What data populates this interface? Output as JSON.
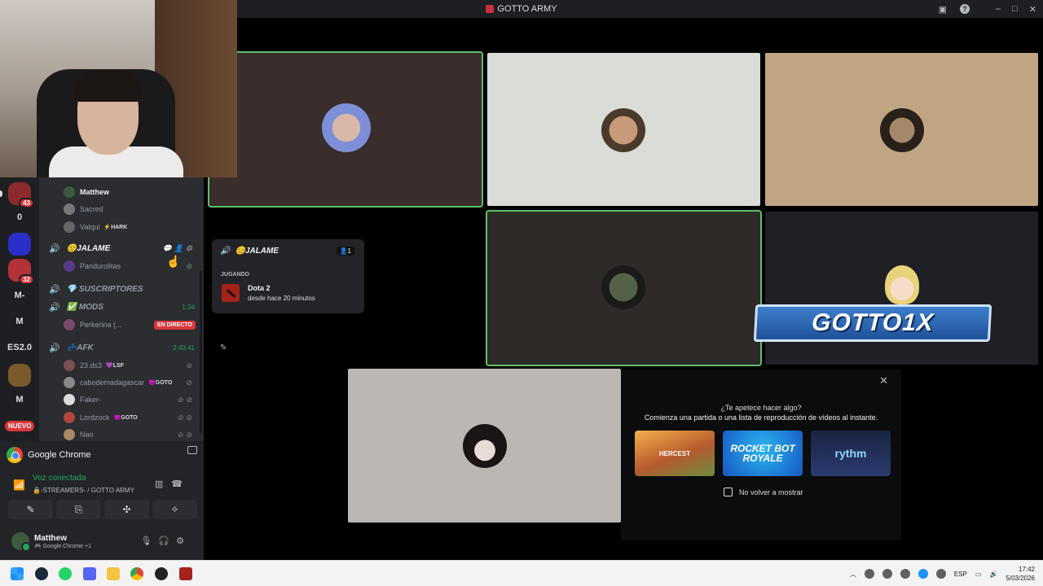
{
  "window": {
    "title": "GOTTO ARMY",
    "controls": [
      "–",
      "□",
      "✕"
    ]
  },
  "servers": [
    {
      "label": "",
      "badge": "43",
      "color": "#8b2b2b",
      "icon": "server-avatar-icon"
    },
    {
      "label": "0",
      "badge": "",
      "color": "#1e1f22",
      "icon": ""
    },
    {
      "label": "",
      "badge": "",
      "color": "#2b2fc9",
      "icon": "server-logo-icon"
    },
    {
      "label": "",
      "badge": "32",
      "color": "#b3323a",
      "icon": "server-avatar-icon"
    },
    {
      "label": "M-",
      "badge": "",
      "color": "#1e1f22",
      "icon": ""
    },
    {
      "label": "M",
      "badge": "",
      "color": "#1e1f22",
      "icon": ""
    },
    {
      "label": "ES2.0",
      "badge": "",
      "color": "#1e1f22",
      "icon": ""
    },
    {
      "label": "",
      "badge": "",
      "color": "#7a5a2a",
      "icon": "server-helmet-icon"
    },
    {
      "label": "M",
      "badge": "",
      "color": "#1e1f22",
      "icon": ""
    }
  ],
  "nuevo_badge": "NUEVO",
  "channel_list": {
    "users_top": [
      {
        "name": "Matthew",
        "tag": "",
        "bright": true,
        "avatar_color": "#3d5a40"
      },
      {
        "name": "Sacred",
        "tag": "",
        "bright": false,
        "avatar_color": "#777"
      },
      {
        "name": "Valqui",
        "tag": "⚡HARK",
        "bright": false,
        "avatar_color": "#666"
      }
    ],
    "channel_jalame": {
      "name": "😊JALAME",
      "active": true
    },
    "jalame_user": {
      "name": "Pandurolitas",
      "avatar_color": "#5b3a8a"
    },
    "channel_suscriptores": {
      "name": "💎 SUSCRIPTORES"
    },
    "channel_mods": {
      "name": "✅ MODS",
      "timer": "1:34"
    },
    "mods_user": {
      "name": "Perkerina (...",
      "live": "EN DIRECTO",
      "avatar_color": "#7a4a6a"
    },
    "channel_afk": {
      "name": "💤AFK",
      "timer": "2:43:41"
    },
    "afk_users": [
      {
        "name": "23.ds3",
        "tag": "💜LSF",
        "avatar_color": "#7a5050"
      },
      {
        "name": "cabodemadagascar",
        "tag": "😈GOTO",
        "avatar_color": "#888"
      },
      {
        "name": "Faker-",
        "tag": "",
        "avatar_color": "#ddd"
      },
      {
        "name": "Lordzock",
        "tag": "😈GOTO",
        "avatar_color": "#b0453a"
      },
      {
        "name": "Nao",
        "tag": "",
        "avatar_color": "#aa8866"
      }
    ]
  },
  "voice_panel": {
    "now_playing": "Google Chrome",
    "status": "Voz conectada",
    "channel": "🔒-STREAMERS- / GOTTO ARMY",
    "user_name": "Matthew",
    "user_activity": "🎮 Google Chrome +1"
  },
  "activity_card": {
    "channel": "😊JALAME",
    "count": "👤1",
    "label": "JUGANDO",
    "game": "Dota 2",
    "since": "desde hace 20 minutos"
  },
  "tiles": [
    {
      "bg": "#3b2d2b",
      "speaking": true,
      "avatar_color": "#7d8fd8"
    },
    {
      "bg": "#d9dcd7",
      "speaking": false,
      "avatar_color": "#7a5a40"
    },
    {
      "bg": "#bfa583",
      "speaking": false,
      "avatar_color": "#3a2d24"
    },
    {
      "bg": "#2d2a28",
      "speaking": true,
      "avatar_color": "#556048"
    },
    {
      "bg": "#1f2025",
      "speaking": false,
      "avatar_color": "#e8d27a"
    },
    {
      "bg": "#bbb7b3",
      "speaking": false,
      "avatar_color": "#2a2220"
    }
  ],
  "stream_banner": "GOTTO1X",
  "suggestion": {
    "title": "¿Te apetece hacer algo?",
    "subtitle": "Comienza una partida o una lista de reproducción de vídeos al instante.",
    "cards": [
      "HERCEST",
      "ROCKET BOT ROYALE",
      "rythm"
    ],
    "checkbox_label": "No volver a mostrar"
  },
  "taskbar": {
    "language": "ESP",
    "time": "17:42",
    "date": "5/03/2026"
  }
}
